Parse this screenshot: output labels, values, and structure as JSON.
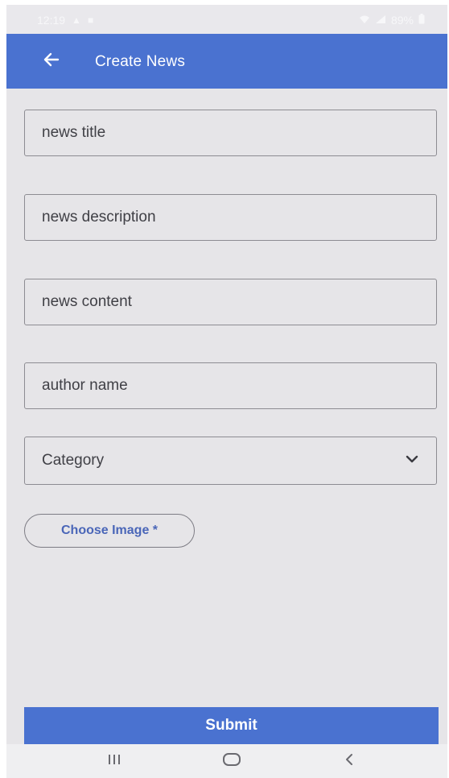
{
  "status_bar": {
    "time": "12:19",
    "left_icons": [
      "warning-icon",
      "image-icon"
    ],
    "battery": "89%"
  },
  "app_bar": {
    "title": "Create News",
    "back_icon": "arrow-left-icon"
  },
  "form": {
    "news_title_placeholder": "news title",
    "news_description_placeholder": "news description",
    "news_content_placeholder": "news content",
    "author_name_placeholder": "author name",
    "category_label": "Category",
    "choose_image_label": "Choose Image *",
    "submit_label": "Submit"
  },
  "colors": {
    "primary": "#4a72d0",
    "background": "#e6e5e8",
    "border": "#8d8c92",
    "text": "#404046",
    "link": "#4a66b8"
  },
  "nav_bar": {
    "icons": [
      "recent-apps-icon",
      "home-icon",
      "back-icon"
    ]
  }
}
